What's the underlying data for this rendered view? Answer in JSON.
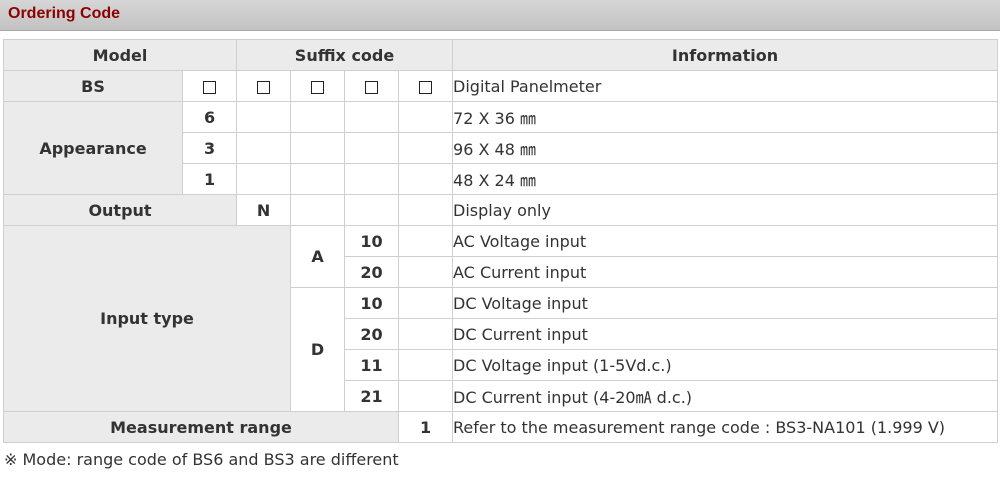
{
  "header": {
    "title": "Ordering Code"
  },
  "table": {
    "headers": {
      "model": "Model",
      "suffix": "Suffix code",
      "info": "Information"
    },
    "bs": {
      "label": "BS",
      "info": "Digital Panelmeter"
    },
    "appearance": {
      "label": "Appearance",
      "rows": [
        {
          "code": "6",
          "info": "72 X 36 ㎜"
        },
        {
          "code": "3",
          "info": "96 X 48 ㎜"
        },
        {
          "code": "1",
          "info": "48 X 24 ㎜"
        }
      ]
    },
    "output": {
      "label": "Output",
      "code": "N",
      "info": "Display only"
    },
    "input_type": {
      "label": "Input type",
      "ac": {
        "code": "A",
        "rows": [
          {
            "code": "10",
            "info": "AC Voltage input"
          },
          {
            "code": "20",
            "info": "AC Current input"
          }
        ]
      },
      "dc": {
        "code": "D",
        "rows": [
          {
            "code": "10",
            "info": "DC Voltage input"
          },
          {
            "code": "20",
            "info": "DC Current input"
          },
          {
            "code": "11",
            "info": "DC Voltage input (1-5Vd.c.)"
          },
          {
            "code": "21",
            "info": "DC Current input (4-20㎃ d.c.)"
          }
        ]
      }
    },
    "measurement": {
      "label": "Measurement range",
      "code": "1",
      "info": "Refer to the measurement range code : BS3-NA101 (1.999 V)"
    }
  },
  "note": "※ Mode: range code of BS6 and BS3 are different"
}
